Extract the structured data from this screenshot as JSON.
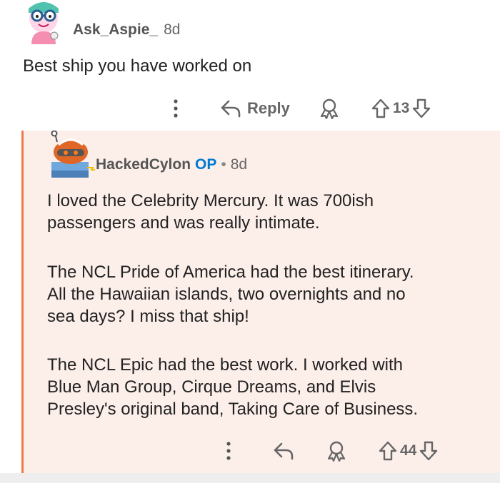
{
  "comment": {
    "username": "Ask_Aspie_",
    "age": "8d",
    "body": "Best ship you have worked on",
    "actions": {
      "reply_label": "Reply",
      "score": "13"
    }
  },
  "reply": {
    "username": "HackedCylon",
    "op_badge": "OP",
    "separator": "•",
    "age": "8d",
    "paragraphs": [
      [
        "I loved the Celebrity Mercury. It was 700ish",
        "passengers and was really intimate."
      ],
      [
        "The NCL Pride of America had the best itinerary.",
        "All the Hawaiian islands, two overnights and no",
        "sea days? I miss that ship!"
      ],
      [
        "The NCL Epic had the best work. I worked with",
        "Blue Man Group, Cirque Dreams, and Elvis",
        "Presley's original band, Taking Care of Business."
      ]
    ],
    "actions": {
      "score": "44"
    }
  },
  "colors": {
    "thread_line": "#ee7b4a",
    "reply_bg": "#fcefea",
    "op": "#0079d3"
  },
  "icons": [
    "more-icon",
    "reply-icon",
    "award-icon",
    "upvote-icon",
    "downvote-icon"
  ]
}
